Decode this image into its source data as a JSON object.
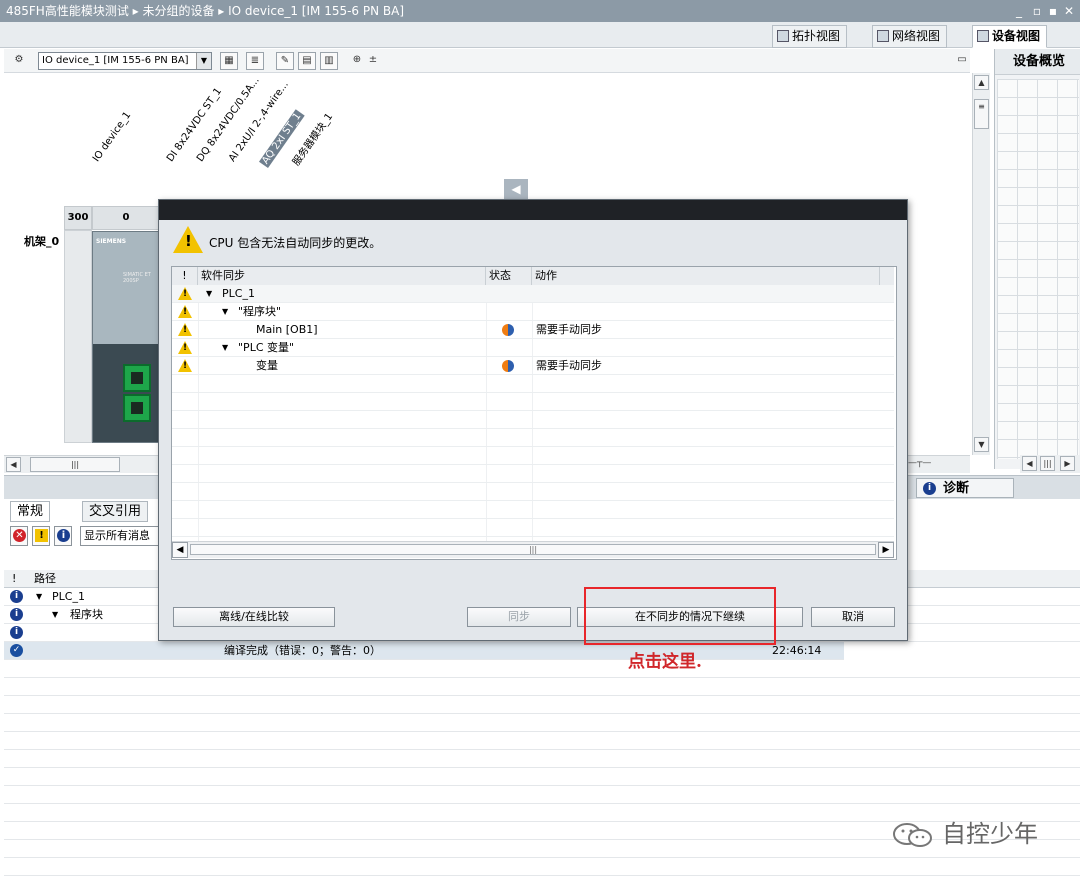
{
  "window": {
    "title": "485FH高性能模块测试 ▸ 未分组的设备 ▸ IO device_1 [IM 155-6 PN BA]",
    "controls": [
      "_",
      "▫",
      "▪",
      "✕"
    ]
  },
  "view_tabs": [
    {
      "label": "拓扑视图",
      "active": false
    },
    {
      "label": "网络视图",
      "active": false
    },
    {
      "label": "设备视图",
      "active": true
    }
  ],
  "device_toolbar": {
    "device_select": "IO device_1 [IM 155-6 PN BA]"
  },
  "canvas": {
    "module_labels": [
      {
        "text": "IO device_1",
        "selected": false
      },
      {
        "text": "DI 8x24VDC ST_1",
        "selected": false
      },
      {
        "text": "DQ 8x24VDC/0.5A...",
        "selected": false
      },
      {
        "text": "AI 2xU/I 2-,4-wire...",
        "selected": false
      },
      {
        "text": "AQ 2xI ST_1",
        "selected": true
      },
      {
        "text": "服务器模块_1",
        "selected": false
      }
    ],
    "slot_numbers": [
      "300",
      "0"
    ],
    "rack_label": "机架_0",
    "module_brand": "SIEMENS",
    "module_model": "SIMATIC ET 200SP"
  },
  "right_panel": {
    "title": "设备概览"
  },
  "inspector": {
    "diag_tab": "诊断",
    "tabs": [
      {
        "label": "常规",
        "active": true
      },
      {
        "label": "交叉引用",
        "active": false
      }
    ],
    "show_all": "显示所有消息",
    "table_header": {
      "path": "路径"
    },
    "rows": [
      {
        "path": "PLC_1",
        "indent": 0,
        "caret": true,
        "message": "",
        "time": ""
      },
      {
        "path": "程序块",
        "indent": 1,
        "caret": true,
        "message": "",
        "time": ""
      },
      {
        "path": "",
        "indent": 0,
        "caret": false,
        "message": "",
        "time": ""
      },
      {
        "path": "",
        "indent": 0,
        "caret": false,
        "message": "编译完成（错误：0；警告：0）",
        "time": "22:46:14",
        "selected": true
      }
    ]
  },
  "dialog": {
    "message": "CPU 包含无法自动同步的更改。",
    "columns": {
      "flag": "!",
      "name": "软件同步",
      "status": "状态",
      "action": "动作"
    },
    "rows": [
      {
        "name": "PLC_1",
        "indent": 0,
        "caret": true,
        "status": false,
        "action": ""
      },
      {
        "name": "\"程序块\"",
        "indent": 1,
        "caret": true,
        "status": false,
        "action": ""
      },
      {
        "name": "Main [OB1]",
        "indent": 2,
        "caret": false,
        "status": true,
        "action": "需要手动同步"
      },
      {
        "name": "\"PLC 变量\"",
        "indent": 1,
        "caret": true,
        "status": false,
        "action": ""
      },
      {
        "name": "变量",
        "indent": 2,
        "caret": false,
        "status": true,
        "action": "需要手动同步"
      }
    ],
    "buttons": {
      "compare": "离线/在线比较",
      "sync": "同步",
      "continue": "在不同步的情况下继续",
      "cancel": "取消"
    }
  },
  "annotation": {
    "text": "点击这里.",
    "color": "#d0262a"
  },
  "watermark": {
    "text": "自控少年"
  }
}
